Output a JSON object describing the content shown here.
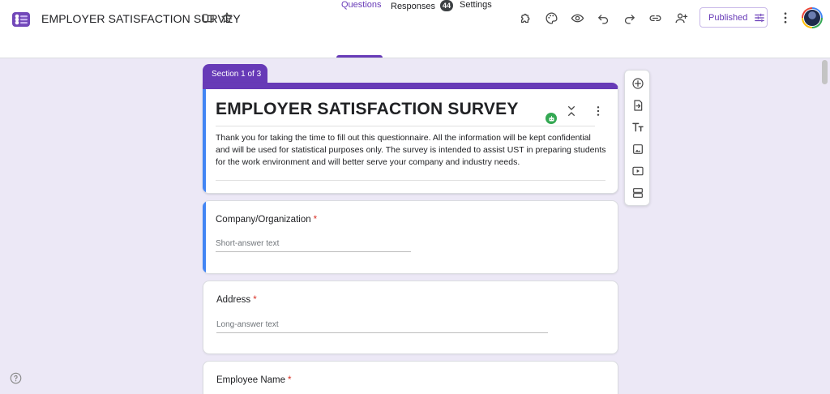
{
  "app": {
    "title": "EMPLOYER SATISFACTION SURVEY",
    "icons": [
      "forms-logo-icon",
      "folder-icon",
      "star-icon"
    ]
  },
  "toolbar": {
    "icons": [
      "addons-puzzle-icon",
      "palette-icon",
      "preview-eye-icon",
      "undo-icon",
      "redo-icon",
      "link-icon",
      "add-collaborator-icon",
      "more-vert-icon"
    ],
    "publish_label": "Published"
  },
  "tabs": [
    {
      "label": "Questions",
      "active": true
    },
    {
      "label": "Responses",
      "badge": "44"
    },
    {
      "label": "Settings"
    }
  ],
  "section": {
    "label": "Section 1 of 3"
  },
  "form": {
    "title": "EMPLOYER SATISFACTION SURVEY",
    "description": "Thank you for taking the time to fill out this questionnaire. All the information will be kept confidential and will be used for statistical purposes only. The survey is intended to assist UST in preparing students for the work environment and will better serve your company and industry needs."
  },
  "questions": [
    {
      "label": "Company/Organization",
      "required": "*",
      "placeholder": "Short-answer text"
    },
    {
      "label": "Address",
      "required": "*",
      "placeholder": "Long-answer text"
    },
    {
      "label": "Employee Name",
      "required": "*"
    }
  ],
  "side_toolbar": [
    "add-question-icon",
    "import-questions-icon",
    "add-title-icon",
    "add-image-icon",
    "add-video-icon",
    "add-section-icon"
  ],
  "colors": {
    "accent": "#673ab7",
    "focus": "#4285f4",
    "background": "#ece8f6",
    "required": "#d93025"
  }
}
